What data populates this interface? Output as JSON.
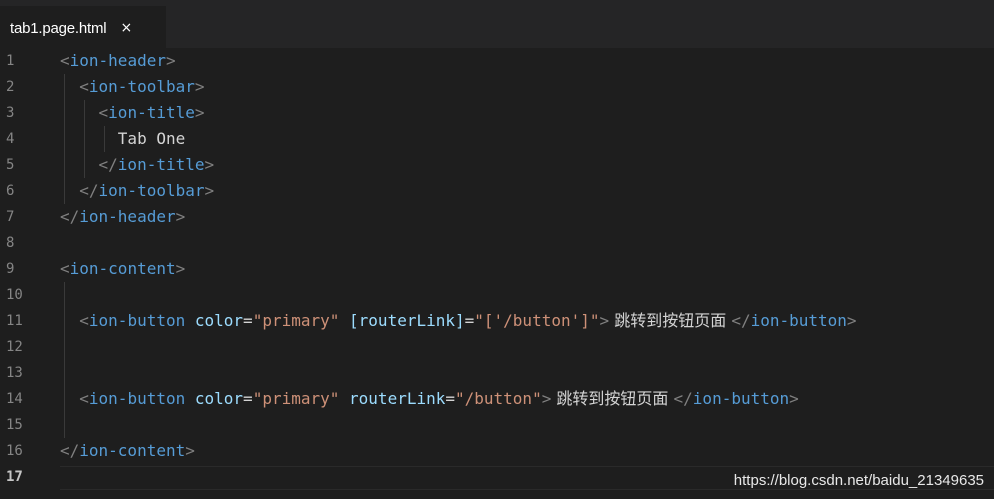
{
  "tab": {
    "title": "tab1.page.html",
    "close": "×"
  },
  "lines": [
    {
      "n": "1",
      "parts": [
        {
          "t": "<",
          "c": "punc"
        },
        {
          "t": "ion-header",
          "c": "tag"
        },
        {
          "t": ">",
          "c": "punc"
        }
      ]
    },
    {
      "n": "2",
      "parts": [
        {
          "t": "  ",
          "c": "txt"
        },
        {
          "t": "<",
          "c": "punc"
        },
        {
          "t": "ion-toolbar",
          "c": "tag"
        },
        {
          "t": ">",
          "c": "punc"
        }
      ]
    },
    {
      "n": "3",
      "parts": [
        {
          "t": "    ",
          "c": "txt"
        },
        {
          "t": "<",
          "c": "punc"
        },
        {
          "t": "ion-title",
          "c": "tag"
        },
        {
          "t": ">",
          "c": "punc"
        }
      ]
    },
    {
      "n": "4",
      "parts": [
        {
          "t": "      Tab One",
          "c": "txt"
        }
      ]
    },
    {
      "n": "5",
      "parts": [
        {
          "t": "    ",
          "c": "txt"
        },
        {
          "t": "</",
          "c": "punc"
        },
        {
          "t": "ion-title",
          "c": "tag"
        },
        {
          "t": ">",
          "c": "punc"
        }
      ]
    },
    {
      "n": "6",
      "parts": [
        {
          "t": "  ",
          "c": "txt"
        },
        {
          "t": "</",
          "c": "punc"
        },
        {
          "t": "ion-toolbar",
          "c": "tag"
        },
        {
          "t": ">",
          "c": "punc"
        }
      ]
    },
    {
      "n": "7",
      "parts": [
        {
          "t": "</",
          "c": "punc"
        },
        {
          "t": "ion-header",
          "c": "tag"
        },
        {
          "t": ">",
          "c": "punc"
        }
      ]
    },
    {
      "n": "8",
      "parts": []
    },
    {
      "n": "9",
      "parts": [
        {
          "t": "<",
          "c": "punc"
        },
        {
          "t": "ion-content",
          "c": "tag"
        },
        {
          "t": ">",
          "c": "punc"
        }
      ]
    },
    {
      "n": "10",
      "parts": []
    },
    {
      "n": "11",
      "parts": [
        {
          "t": "  ",
          "c": "txt"
        },
        {
          "t": "<",
          "c": "punc"
        },
        {
          "t": "ion-button",
          "c": "tag"
        },
        {
          "t": " ",
          "c": "txt"
        },
        {
          "t": "color",
          "c": "attr"
        },
        {
          "t": "=",
          "c": "txt"
        },
        {
          "t": "\"primary\"",
          "c": "str"
        },
        {
          "t": " ",
          "c": "txt"
        },
        {
          "t": "[routerLink]",
          "c": "attr"
        },
        {
          "t": "=",
          "c": "txt"
        },
        {
          "t": "\"['/button']\"",
          "c": "str"
        },
        {
          "t": ">",
          "c": "punc"
        },
        {
          "t": " 跳转到按钮页面 ",
          "c": "cn"
        },
        {
          "t": "</",
          "c": "punc"
        },
        {
          "t": "ion-button",
          "c": "tag"
        },
        {
          "t": ">",
          "c": "punc"
        }
      ]
    },
    {
      "n": "12",
      "parts": []
    },
    {
      "n": "13",
      "parts": []
    },
    {
      "n": "14",
      "parts": [
        {
          "t": "  ",
          "c": "txt"
        },
        {
          "t": "<",
          "c": "punc"
        },
        {
          "t": "ion-button",
          "c": "tag"
        },
        {
          "t": " ",
          "c": "txt"
        },
        {
          "t": "color",
          "c": "attr"
        },
        {
          "t": "=",
          "c": "txt"
        },
        {
          "t": "\"primary\"",
          "c": "str"
        },
        {
          "t": " ",
          "c": "txt"
        },
        {
          "t": "routerLink",
          "c": "attr"
        },
        {
          "t": "=",
          "c": "txt"
        },
        {
          "t": "\"/button\"",
          "c": "str"
        },
        {
          "t": ">",
          "c": "punc"
        },
        {
          "t": " 跳转到按钮页面 ",
          "c": "cn"
        },
        {
          "t": "</",
          "c": "punc"
        },
        {
          "t": "ion-button",
          "c": "tag"
        },
        {
          "t": ">",
          "c": "punc"
        }
      ]
    },
    {
      "n": "15",
      "parts": []
    },
    {
      "n": "16",
      "parts": [
        {
          "t": "</",
          "c": "punc"
        },
        {
          "t": "ion-content",
          "c": "tag"
        },
        {
          "t": ">",
          "c": "punc"
        }
      ]
    },
    {
      "n": "17",
      "parts": [],
      "active": true
    }
  ],
  "watermark": "https://blog.csdn.net/baidu_21349635"
}
